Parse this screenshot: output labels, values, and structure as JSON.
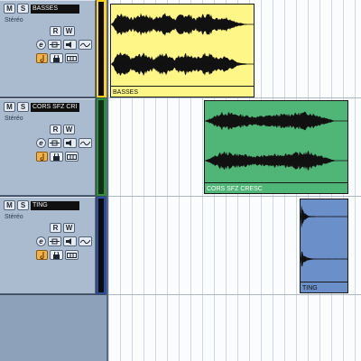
{
  "tracks": [
    {
      "mute_label": "M",
      "solo_label": "S",
      "name": "BASSES",
      "channel_mode": "Stéréo",
      "read_label": "R",
      "write_label": "W",
      "edit_label": "e",
      "strip_color": "#ffd21a"
    },
    {
      "mute_label": "M",
      "solo_label": "S",
      "name": "CORS SFZ CRI",
      "channel_mode": "Stéréo",
      "read_label": "R",
      "write_label": "W",
      "edit_label": "e",
      "strip_color": "#2f8f3a"
    },
    {
      "mute_label": "M",
      "solo_label": "S",
      "name": "TING",
      "channel_mode": "Stéréo",
      "read_label": "R",
      "write_label": "W",
      "edit_label": "e",
      "strip_color": "#2b4e9a"
    }
  ],
  "events": [
    {
      "name": "BASSES",
      "color": "#fff688",
      "waveform": "sustained-pulsing"
    },
    {
      "name": "CORS SFZ CRESC",
      "color": "#4fb677",
      "waveform": "swell"
    },
    {
      "name": "TING",
      "color": "#6b8fc9",
      "waveform": "decay-hit"
    }
  ],
  "icons": {
    "monitor": "speaker-icon",
    "timebase": "note-icon",
    "lock": "lock-icon",
    "lane": "lane-icon",
    "insert": "insert-icon",
    "eq": "eq-icon"
  }
}
